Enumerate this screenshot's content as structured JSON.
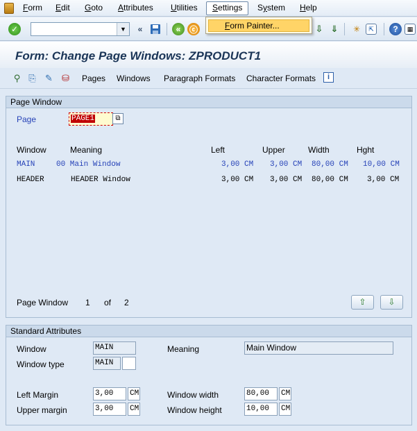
{
  "menubar": {
    "items": [
      "Form",
      "Edit",
      "Goto",
      "Attributes",
      "Utilities",
      "Settings",
      "System",
      "Help"
    ],
    "underline_letters": [
      "F",
      "E",
      "G",
      "A",
      "U",
      "S",
      "y",
      "H"
    ]
  },
  "settings_menu": {
    "item": "Form Painter..."
  },
  "page_title": "Form: Change Page Windows: ZPRODUCT1",
  "app_toolbar": {
    "links": [
      "Pages",
      "Windows",
      "Paragraph Formats",
      "Character Formats"
    ]
  },
  "page_window_group": {
    "title": "Page Window",
    "page_label": "Page",
    "page_value": "PAGE1",
    "columns": [
      "Window",
      "Meaning",
      "Left",
      "Upper",
      "Width",
      "Hght"
    ],
    "rows": [
      {
        "window": "MAIN",
        "meaning": "00 Main Window",
        "left": "3,00 CM",
        "upper": "3,00 CM",
        "width": "80,00 CM",
        "hght": "10,00 CM"
      },
      {
        "window": "HEADER",
        "meaning": "HEADER Window",
        "left": "3,00 CM",
        "upper": "3,00 CM",
        "width": "80,00 CM",
        "hght": "3,00 CM"
      }
    ],
    "pager_label": "Page Window",
    "pager_current": "1",
    "pager_of": "of",
    "pager_total": "2"
  },
  "standard_attributes": {
    "title": "Standard Attributes",
    "window_label": "Window",
    "window_value": "MAIN",
    "meaning_label": "Meaning",
    "meaning_value": "Main Window",
    "window_type_label": "Window type",
    "window_type_value": "MAIN",
    "left_margin_label": "Left Margin",
    "left_margin_value": "3,00",
    "left_margin_unit": "CM",
    "upper_margin_label": "Upper margin",
    "upper_margin_value": "3,00",
    "upper_margin_unit": "CM",
    "window_width_label": "Window width",
    "window_width_value": "80,00",
    "window_width_unit": "CM",
    "window_height_label": "Window height",
    "window_height_value": "10,00",
    "window_height_unit": "CM"
  },
  "icons": {
    "enter": "check-icon",
    "save": "save-icon",
    "back": "back-icon",
    "exit": "exit-icon",
    "help": "help-icon",
    "layout": "layout-icon"
  },
  "colors": {
    "accent_blue": "#2743b8",
    "selected_red": "#c00000",
    "menu_highlight": "#ffd467"
  }
}
